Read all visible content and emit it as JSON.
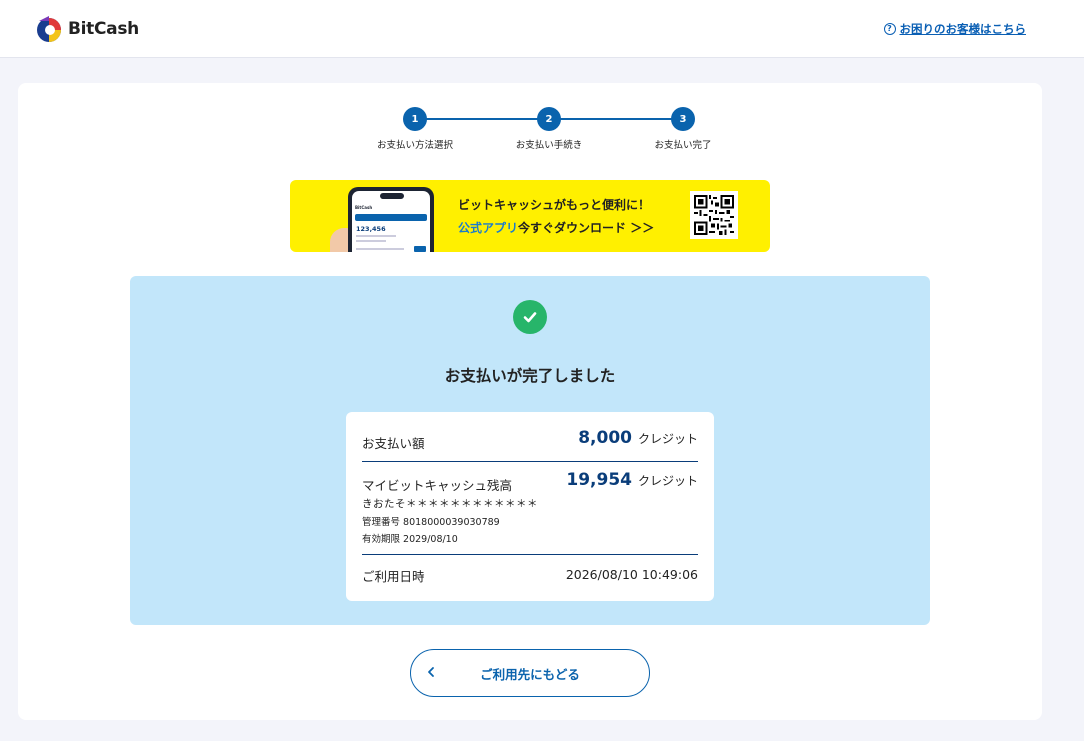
{
  "header": {
    "logo_text": "BitCash",
    "help_icon": "?",
    "help_link": "お困りのお客様はこちら"
  },
  "stepper": {
    "steps": [
      {
        "number": "1",
        "label": "お支払い方法選択"
      },
      {
        "number": "2",
        "label": "お支払い手続き"
      },
      {
        "number": "3",
        "label": "お支払い完了"
      }
    ]
  },
  "banner": {
    "line1": "ビットキャッシュがもっと便利に！",
    "line2_accent": "公式アプリ",
    "line2_rest": "今すぐダウンロード ＞＞",
    "phone_amount": "123,456",
    "phone_logo": "BitCash"
  },
  "result": {
    "title": "お支払いが完了しました",
    "payment_label": "お支払い額",
    "payment_amount": "8,000",
    "payment_unit": "クレジット",
    "balance_label": "マイビットキャッシュ残高",
    "balance_amount": "19,954",
    "balance_unit": "クレジット",
    "account_masked": "きおたそ＊＊＊＊＊＊＊＊＊＊＊＊",
    "management_number": "管理番号 8018000039030789",
    "expiry": "有効期限 2029/08/10",
    "date_label": "ご利用日時",
    "date_value": "2026/08/10 10:49:06"
  },
  "back_button": {
    "label": "ご利用先にもどる"
  },
  "colors": {
    "primary": "#0a63ad",
    "navy": "#0a3d7a",
    "banner_yellow": "#fff000",
    "panel_blue": "#c2e6fa",
    "success_green": "#27b56a"
  }
}
